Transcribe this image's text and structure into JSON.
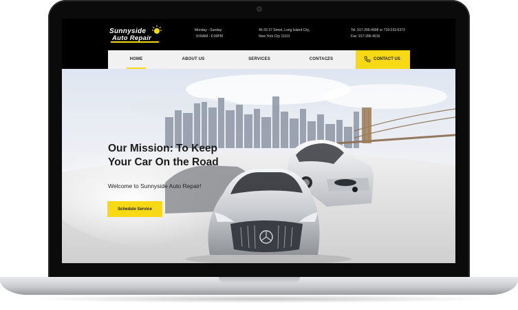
{
  "brand": {
    "logo_line1": "Sunnyside",
    "logo_line2": "Auto Repair"
  },
  "header": {
    "hours_days": "Monday - Sunday",
    "hours_time": "9:00AM - 6:00PM",
    "address_line1": "45-33 37 Street, Long Island City,",
    "address_line2": "New York City 11101",
    "tel": "Tel: 917-396-4908 or 718-233-6373",
    "fax": "Fax: 917-396-4916"
  },
  "nav": {
    "items": [
      {
        "label": "HOME",
        "active": true
      },
      {
        "label": "ABOUT US",
        "active": false
      },
      {
        "label": "SERVICES",
        "active": false
      },
      {
        "label": "CONTACTS",
        "active": false
      }
    ],
    "cta_label": "CONTACT US"
  },
  "hero": {
    "headline_line1": "Our Mission: To Keep",
    "headline_line2": "Your Car On the Road",
    "welcome": "Welcome to Sunnyside Auto Repair!",
    "button_label": "Schedule Service"
  },
  "colors": {
    "accent": "#f7d916",
    "header_bg": "#000000",
    "nav_bg": "#f1f1f1",
    "text_dark": "#1c1c1c"
  },
  "icons": [
    "sun-logo-icon",
    "chevron-down-icon",
    "phone-icon",
    "camera-icon"
  ]
}
